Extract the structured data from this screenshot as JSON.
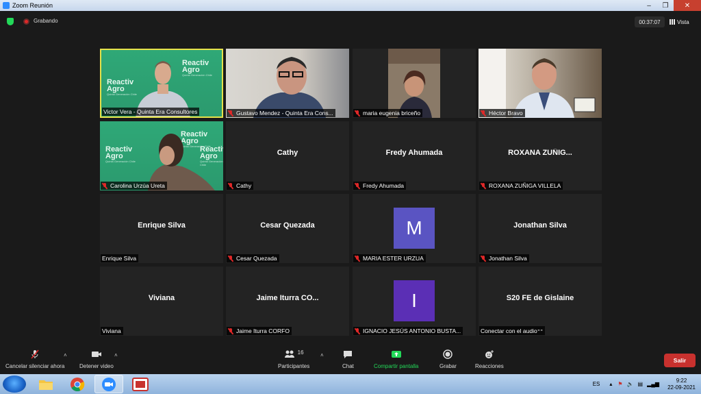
{
  "window": {
    "title": "Zoom Reunión",
    "min": "–",
    "max": "❐",
    "close": "✕"
  },
  "topbar": {
    "recording": "Grabando",
    "timer": "00:37:07",
    "view_label": "Vista"
  },
  "brand": {
    "name_top": "Reactiv",
    "name_bottom": "Agro"
  },
  "tiles": [
    {
      "name": "Victor Vera - Quinta Era Consultores",
      "big": "",
      "muted": false,
      "kind": "video-green-man",
      "active": true
    },
    {
      "name": "Gustavo Mendez - Quinta Era Cons...",
      "big": "",
      "muted": true,
      "kind": "video-office"
    },
    {
      "name": "maria eugenia briceño",
      "big": "",
      "muted": true,
      "kind": "video-woman"
    },
    {
      "name": "Héctor Bravo",
      "big": "",
      "muted": true,
      "kind": "video-man-window"
    },
    {
      "name": "Carolina Urzúa Ureta",
      "big": "",
      "muted": true,
      "kind": "video-green-woman"
    },
    {
      "name": "Cathy",
      "big": "Cathy",
      "muted": true,
      "kind": "name"
    },
    {
      "name": "Fredy Ahumada",
      "big": "Fredy Ahumada",
      "muted": true,
      "kind": "name"
    },
    {
      "name": "ROXANA ZUÑIGA VILLELA",
      "big": "ROXANA  ZUÑIG...",
      "muted": true,
      "kind": "name"
    },
    {
      "name": "Enrique Silva",
      "big": "Enrique Silva",
      "muted": false,
      "kind": "name"
    },
    {
      "name": "Cesar Quezada",
      "big": "Cesar Quezada",
      "muted": true,
      "kind": "name"
    },
    {
      "name": "MARIA ESTER URZUA",
      "big": "M",
      "muted": true,
      "kind": "avatar",
      "color": "#5a54c2"
    },
    {
      "name": "Jonathan Silva",
      "big": "Jonathan Silva",
      "muted": true,
      "kind": "name"
    },
    {
      "name": "Viviana",
      "big": "Viviana",
      "muted": false,
      "kind": "name"
    },
    {
      "name": "Jaime Iturra CORFO",
      "big": "Jaime Iturra CO...",
      "muted": true,
      "kind": "name"
    },
    {
      "name": "IGNACIO  JESÚS ANTONIO BUSTA...",
      "big": "I",
      "muted": true,
      "kind": "avatar",
      "color": "#5b2fb5"
    },
    {
      "name": "Conectar con el audio",
      "big": "S20 FE de Gislaine",
      "muted": false,
      "kind": "name"
    }
  ],
  "toolbar": {
    "unmute": "Cancelar silenciar ahora",
    "stop_video": "Detener video",
    "participants": "Participantes",
    "participants_count": "16",
    "chat": "Chat",
    "share": "Compartir pantalla",
    "record": "Grabar",
    "reactions": "Reacciones",
    "leave": "Salir"
  },
  "taskbar": {
    "lang": "ES",
    "time": "9:22",
    "date": "22-09-2021"
  },
  "colors": {
    "share_green": "#23d959",
    "leave_red": "#c8312e",
    "active_border": "#e6e24a"
  }
}
